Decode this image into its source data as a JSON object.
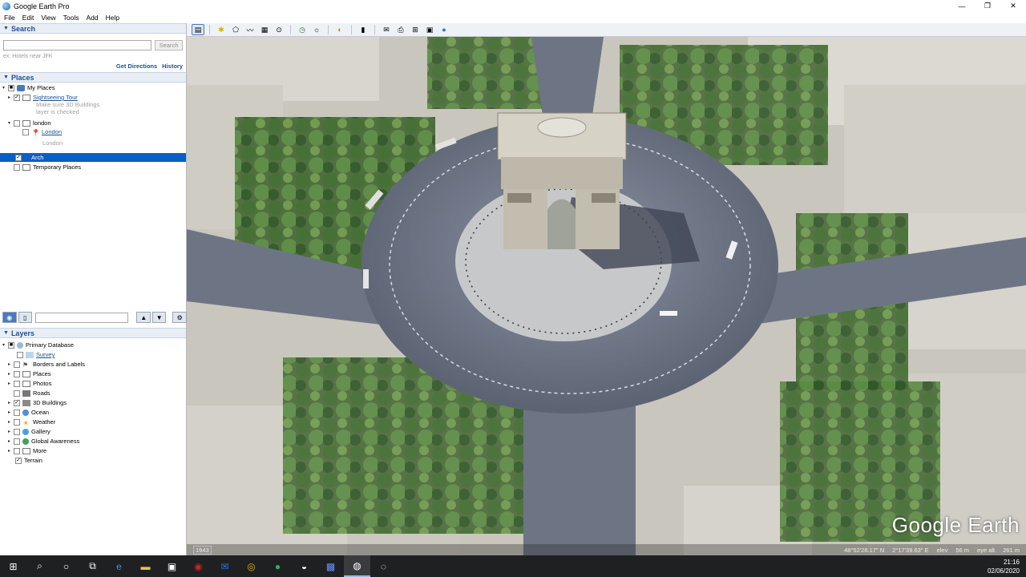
{
  "window": {
    "title": "Google Earth Pro",
    "controls": [
      "—",
      "❐",
      "✕"
    ]
  },
  "menu": [
    "File",
    "Edit",
    "View",
    "Tools",
    "Add",
    "Help"
  ],
  "search": {
    "header": "Search",
    "placeholder": "",
    "button": "Search",
    "hint": "ex: Hotels near JFK",
    "get_directions": "Get Directions",
    "history": "History"
  },
  "places": {
    "header": "Places",
    "items": [
      {
        "label": "My Places"
      },
      {
        "label": "Sightseeing Tour"
      },
      {
        "label": "Make sure 3D Buildings"
      },
      {
        "label": "layer is checked"
      },
      {
        "label": "london"
      },
      {
        "label": "London"
      },
      {
        "label": "London"
      },
      {
        "label": "Arch"
      },
      {
        "label": "Temporary Places"
      }
    ]
  },
  "layers": {
    "header": "Layers",
    "items": [
      {
        "label": "Primary Database"
      },
      {
        "label": "Survey"
      },
      {
        "label": "Borders and Labels"
      },
      {
        "label": "Places"
      },
      {
        "label": "Photos"
      },
      {
        "label": "Roads"
      },
      {
        "label": "3D Buildings"
      },
      {
        "label": "Ocean"
      },
      {
        "label": "Weather"
      },
      {
        "label": "Gallery"
      },
      {
        "label": "Global Awareness"
      },
      {
        "label": "More"
      },
      {
        "label": "Terrain"
      }
    ]
  },
  "map": {
    "logo": "Google Earth",
    "year": "1943",
    "lat": "48°52'28.17\" N",
    "lon": "2°17'39.63\" E",
    "elev_label": "elev",
    "elev": "56 m",
    "eye_label": "eye alt",
    "eye": "261 m"
  },
  "taskbar": {
    "time": "21:16",
    "date": "02/06/2020"
  }
}
